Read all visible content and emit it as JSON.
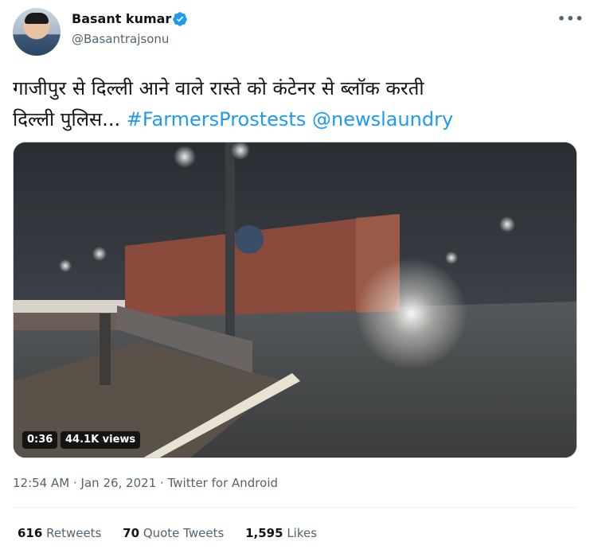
{
  "author": {
    "name": "Basant kumar",
    "handle": "@Basantrajsonu",
    "verified": true
  },
  "tweet": {
    "text_line1": "गाजीपुर से दिल्ली आने वाले रास्ते को कंटेनर से ब्लॉक करती",
    "text_line2_prefix": "दिल्ली पुलिस...",
    "hashtag": "#FarmersProstests",
    "mention": "@newslaundry"
  },
  "video": {
    "duration": "0:36",
    "views": "44.1K views"
  },
  "meta": {
    "time": "12:54 AM",
    "date": "Jan 26, 2021",
    "source": "Twitter for Android",
    "separator": "·"
  },
  "stats": {
    "retweets_count": "616",
    "retweets_label": "Retweets",
    "quotes_count": "70",
    "quotes_label": "Quote Tweets",
    "likes_count": "1,595",
    "likes_label": "Likes"
  },
  "icons": {
    "more": "more-icon",
    "verified": "verified-badge-icon"
  },
  "colors": {
    "link": "#1d9bf0",
    "secondary_text": "#536471",
    "verified": "#1d9bf0"
  }
}
